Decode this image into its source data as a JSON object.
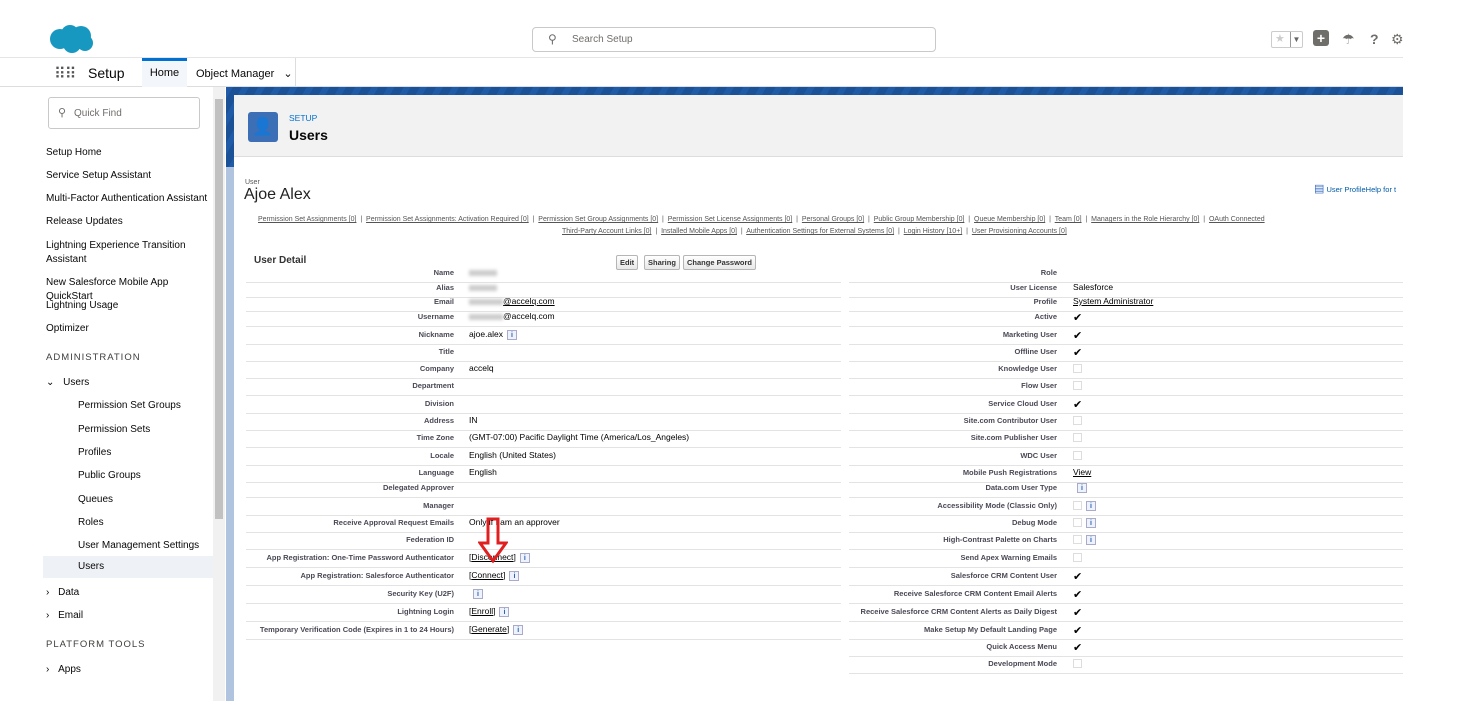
{
  "topbar": {
    "search_placeholder": "Search Setup"
  },
  "nav": {
    "app_name": "Setup",
    "tabs": [
      "Home",
      "Object Manager"
    ]
  },
  "sidebar": {
    "quick_find_placeholder": "Quick Find",
    "items": [
      {
        "label": "Setup Home",
        "type": "item"
      },
      {
        "label": "Service Setup Assistant",
        "type": "item"
      },
      {
        "label": "Multi-Factor Authentication Assistant",
        "type": "item"
      },
      {
        "label": "Release Updates",
        "type": "item"
      },
      {
        "label": "Lightning Experience Transition Assistant",
        "type": "item"
      },
      {
        "label": "New Salesforce Mobile App QuickStart",
        "type": "item"
      },
      {
        "label": "Lightning Usage",
        "type": "item"
      },
      {
        "label": "Optimizer",
        "type": "item"
      },
      {
        "label": "ADMINISTRATION",
        "type": "head"
      },
      {
        "label": "Users",
        "type": "expanded"
      },
      {
        "label": "Permission Set Groups",
        "type": "sub"
      },
      {
        "label": "Permission Sets",
        "type": "sub"
      },
      {
        "label": "Profiles",
        "type": "sub"
      },
      {
        "label": "Public Groups",
        "type": "sub"
      },
      {
        "label": "Queues",
        "type": "sub"
      },
      {
        "label": "Roles",
        "type": "sub"
      },
      {
        "label": "User Management Settings",
        "type": "sub"
      },
      {
        "label": "Users",
        "type": "selected"
      },
      {
        "label": "Data",
        "type": "collapsed"
      },
      {
        "label": "Email",
        "type": "collapsed"
      },
      {
        "label": "PLATFORM TOOLS",
        "type": "head"
      },
      {
        "label": "Apps",
        "type": "collapsed"
      }
    ]
  },
  "page_header": {
    "breadcrumb": "SETUP",
    "title": "Users"
  },
  "user": {
    "label": "User",
    "name": "Ajoe Alex",
    "help_link": "User ProfileHelp for t"
  },
  "related_links": [
    [
      "Permission Set Assignments [0]",
      "Permission Set Assignments: Activation Required [0]",
      "Permission Set Group Assignments [0]",
      "Permission Set License Assignments [0]",
      "Personal Groups [0]",
      "Public Group Membership [0]",
      "Queue Membership [0]",
      "Team [0]",
      "Managers in the Role Hierarchy [0]",
      "OAuth Connected"
    ],
    [
      "Third-Party Account Links [0]",
      "Installed Mobile Apps [0]",
      "Authentication Settings for External Systems [0]",
      "Login History [10+]",
      "User Provisioning Accounts [0]"
    ]
  ],
  "detail": {
    "title": "User Detail",
    "buttons": [
      "Edit",
      "Sharing",
      "Change Password"
    ],
    "left": [
      {
        "label": "Name",
        "blur": true
      },
      {
        "label": "Alias",
        "blur": true
      },
      {
        "label": "Email",
        "value": "@accelq.com",
        "blur": true,
        "link": true
      },
      {
        "label": "Username",
        "value": "@accelq.com",
        "blur": true
      },
      {
        "label": "Nickname",
        "value": "ajoe.alex",
        "info": true
      },
      {
        "label": "Title"
      },
      {
        "label": "Company",
        "value": "accelq"
      },
      {
        "label": "Department"
      },
      {
        "label": "Division"
      },
      {
        "label": "Address",
        "value": "IN"
      },
      {
        "label": "Time Zone",
        "value": "(GMT-07:00) Pacific Daylight Time (America/Los_Angeles)"
      },
      {
        "label": "Locale",
        "value": "English (United States)"
      },
      {
        "label": "Language",
        "value": "English"
      },
      {
        "label": "Delegated Approver"
      },
      {
        "label": "Manager"
      },
      {
        "label": "Receive Approval Request Emails",
        "value": "Only if I am an approver"
      },
      {
        "label": "Federation ID"
      },
      {
        "label": "App Registration: One-Time Password Authenticator",
        "value": "Disconnect",
        "link": true,
        "bracket": true,
        "info": true
      },
      {
        "label": "App Registration: Salesforce Authenticator",
        "value": "Connect",
        "link": true,
        "bracket": true,
        "info": true
      },
      {
        "label": "Security Key (U2F)",
        "info": true
      },
      {
        "label": "Lightning Login",
        "value": "Enroll",
        "link": true,
        "bracket": true,
        "info": true
      },
      {
        "label": "Temporary Verification Code (Expires in 1 to 24 Hours)",
        "value": "Generate",
        "link": true,
        "bracket": true,
        "info": true
      }
    ],
    "right": [
      {
        "label": "Role"
      },
      {
        "label": "User License",
        "value": "Salesforce"
      },
      {
        "label": "Profile",
        "value": "System Administrator",
        "link": true
      },
      {
        "label": "Active",
        "check": true
      },
      {
        "label": "Marketing User",
        "check": true
      },
      {
        "label": "Offline User",
        "check": true
      },
      {
        "label": "Knowledge User",
        "check": false
      },
      {
        "label": "Flow User",
        "check": false
      },
      {
        "label": "Service Cloud User",
        "check": true
      },
      {
        "label": "Site.com Contributor User",
        "check": false
      },
      {
        "label": "Site.com Publisher User",
        "check": false
      },
      {
        "label": "WDC User",
        "check": false
      },
      {
        "label": "Mobile Push Registrations",
        "value": "View",
        "link": true
      },
      {
        "label": "Data.com User Type",
        "info": true
      },
      {
        "label": "Accessibility Mode (Classic Only)",
        "check": false,
        "info": true
      },
      {
        "label": "Debug Mode",
        "check": false,
        "info": true
      },
      {
        "label": "High-Contrast Palette on Charts",
        "check": false,
        "info": true
      },
      {
        "label": "Send Apex Warning Emails",
        "check": false
      },
      {
        "label": "Salesforce CRM Content User",
        "check": true
      },
      {
        "label": "Receive Salesforce CRM Content Email Alerts",
        "check": true
      },
      {
        "label": "Receive Salesforce CRM Content Alerts as Daily Digest",
        "check": true
      },
      {
        "label": "Make Setup My Default Landing Page",
        "check": true
      },
      {
        "label": "Quick Access Menu",
        "check": true
      },
      {
        "label": "Development Mode",
        "check": false
      }
    ]
  },
  "colors": {
    "brand": "#1b5297",
    "link": "#0070d2",
    "annotation_arrow": "#e02020"
  }
}
